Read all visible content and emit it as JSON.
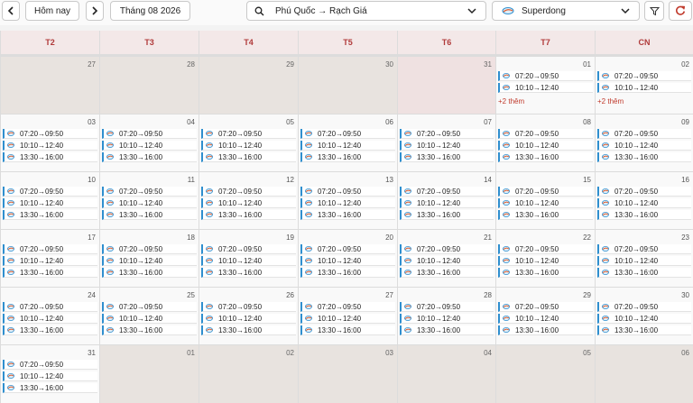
{
  "toolbar": {
    "today_label": "Hôm nay",
    "month_label": "Tháng 08 2026",
    "route_value": "Phú Quốc → Rạch Giá",
    "operator_value": "Superdong"
  },
  "weekdays": [
    "T2",
    "T3",
    "T4",
    "T5",
    "T6",
    "T7",
    "CN"
  ],
  "more_label": "+2 thêm",
  "days": [
    {
      "n": "27",
      "out": true,
      "hl": false,
      "events": [],
      "more": false
    },
    {
      "n": "28",
      "out": true,
      "hl": false,
      "events": [],
      "more": false
    },
    {
      "n": "29",
      "out": true,
      "hl": false,
      "events": [],
      "more": false
    },
    {
      "n": "30",
      "out": true,
      "hl": false,
      "events": [],
      "more": false
    },
    {
      "n": "31",
      "out": true,
      "hl": true,
      "events": [],
      "more": false
    },
    {
      "n": "01",
      "out": false,
      "hl": false,
      "events": [
        "07:20→09:50",
        "10:10→12:40"
      ],
      "more": true
    },
    {
      "n": "02",
      "out": false,
      "hl": false,
      "events": [
        "07:20→09:50",
        "10:10→12:40"
      ],
      "more": true
    },
    {
      "n": "03",
      "out": false,
      "hl": false,
      "events": [
        "07:20→09:50",
        "10:10→12:40",
        "13:30→16:00"
      ],
      "more": false
    },
    {
      "n": "04",
      "out": false,
      "hl": false,
      "events": [
        "07:20→09:50",
        "10:10→12:40",
        "13:30→16:00"
      ],
      "more": false
    },
    {
      "n": "05",
      "out": false,
      "hl": false,
      "events": [
        "07:20→09:50",
        "10:10→12:40",
        "13:30→16:00"
      ],
      "more": false
    },
    {
      "n": "06",
      "out": false,
      "hl": false,
      "events": [
        "07:20→09:50",
        "10:10→12:40",
        "13:30→16:00"
      ],
      "more": false
    },
    {
      "n": "07",
      "out": false,
      "hl": false,
      "events": [
        "07:20→09:50",
        "10:10→12:40",
        "13:30→16:00"
      ],
      "more": false
    },
    {
      "n": "08",
      "out": false,
      "hl": false,
      "events": [
        "07:20→09:50",
        "10:10→12:40",
        "13:30→16:00"
      ],
      "more": false
    },
    {
      "n": "09",
      "out": false,
      "hl": false,
      "events": [
        "07:20→09:50",
        "10:10→12:40",
        "13:30→16:00"
      ],
      "more": false
    },
    {
      "n": "10",
      "out": false,
      "hl": false,
      "events": [
        "07:20→09:50",
        "10:10→12:40",
        "13:30→16:00"
      ],
      "more": false
    },
    {
      "n": "11",
      "out": false,
      "hl": false,
      "events": [
        "07:20→09:50",
        "10:10→12:40",
        "13:30→16:00"
      ],
      "more": false
    },
    {
      "n": "12",
      "out": false,
      "hl": false,
      "events": [
        "07:20→09:50",
        "10:10→12:40",
        "13:30→16:00"
      ],
      "more": false
    },
    {
      "n": "13",
      "out": false,
      "hl": false,
      "events": [
        "07:20→09:50",
        "10:10→12:40",
        "13:30→16:00"
      ],
      "more": false
    },
    {
      "n": "14",
      "out": false,
      "hl": false,
      "events": [
        "07:20→09:50",
        "10:10→12:40",
        "13:30→16:00"
      ],
      "more": false
    },
    {
      "n": "15",
      "out": false,
      "hl": false,
      "events": [
        "07:20→09:50",
        "10:10→12:40",
        "13:30→16:00"
      ],
      "more": false
    },
    {
      "n": "16",
      "out": false,
      "hl": false,
      "events": [
        "07:20→09:50",
        "10:10→12:40",
        "13:30→16:00"
      ],
      "more": false
    },
    {
      "n": "17",
      "out": false,
      "hl": false,
      "events": [
        "07:20→09:50",
        "10:10→12:40",
        "13:30→16:00"
      ],
      "more": false
    },
    {
      "n": "18",
      "out": false,
      "hl": false,
      "events": [
        "07:20→09:50",
        "10:10→12:40",
        "13:30→16:00"
      ],
      "more": false
    },
    {
      "n": "19",
      "out": false,
      "hl": false,
      "events": [
        "07:20→09:50",
        "10:10→12:40",
        "13:30→16:00"
      ],
      "more": false
    },
    {
      "n": "20",
      "out": false,
      "hl": false,
      "events": [
        "07:20→09:50",
        "10:10→12:40",
        "13:30→16:00"
      ],
      "more": false
    },
    {
      "n": "21",
      "out": false,
      "hl": false,
      "events": [
        "07:20→09:50",
        "10:10→12:40",
        "13:30→16:00"
      ],
      "more": false
    },
    {
      "n": "22",
      "out": false,
      "hl": false,
      "events": [
        "07:20→09:50",
        "10:10→12:40",
        "13:30→16:00"
      ],
      "more": false
    },
    {
      "n": "23",
      "out": false,
      "hl": false,
      "events": [
        "07:20→09:50",
        "10:10→12:40",
        "13:30→16:00"
      ],
      "more": false
    },
    {
      "n": "24",
      "out": false,
      "hl": false,
      "events": [
        "07:20→09:50",
        "10:10→12:40",
        "13:30→16:00"
      ],
      "more": false
    },
    {
      "n": "25",
      "out": false,
      "hl": false,
      "events": [
        "07:20→09:50",
        "10:10→12:40",
        "13:30→16:00"
      ],
      "more": false
    },
    {
      "n": "26",
      "out": false,
      "hl": false,
      "events": [
        "07:20→09:50",
        "10:10→12:40",
        "13:30→16:00"
      ],
      "more": false
    },
    {
      "n": "27",
      "out": false,
      "hl": false,
      "events": [
        "07:20→09:50",
        "10:10→12:40",
        "13:30→16:00"
      ],
      "more": false
    },
    {
      "n": "28",
      "out": false,
      "hl": false,
      "events": [
        "07:20→09:50",
        "10:10→12:40",
        "13:30→16:00"
      ],
      "more": false
    },
    {
      "n": "29",
      "out": false,
      "hl": false,
      "events": [
        "07:20→09:50",
        "10:10→12:40",
        "13:30→16:00"
      ],
      "more": false
    },
    {
      "n": "30",
      "out": false,
      "hl": false,
      "events": [
        "07:20→09:50",
        "10:10→12:40",
        "13:30→16:00"
      ],
      "more": false
    },
    {
      "n": "31",
      "out": false,
      "hl": false,
      "events": [
        "07:20→09:50",
        "10:10→12:40",
        "13:30→16:00"
      ],
      "more": false
    },
    {
      "n": "01",
      "out": true,
      "hl": false,
      "events": [],
      "more": false
    },
    {
      "n": "02",
      "out": true,
      "hl": false,
      "events": [],
      "more": false
    },
    {
      "n": "03",
      "out": true,
      "hl": false,
      "events": [],
      "more": false
    },
    {
      "n": "04",
      "out": true,
      "hl": false,
      "events": [],
      "more": false
    },
    {
      "n": "05",
      "out": true,
      "hl": false,
      "events": [],
      "more": false
    },
    {
      "n": "06",
      "out": true,
      "hl": false,
      "events": [],
      "more": false
    }
  ]
}
